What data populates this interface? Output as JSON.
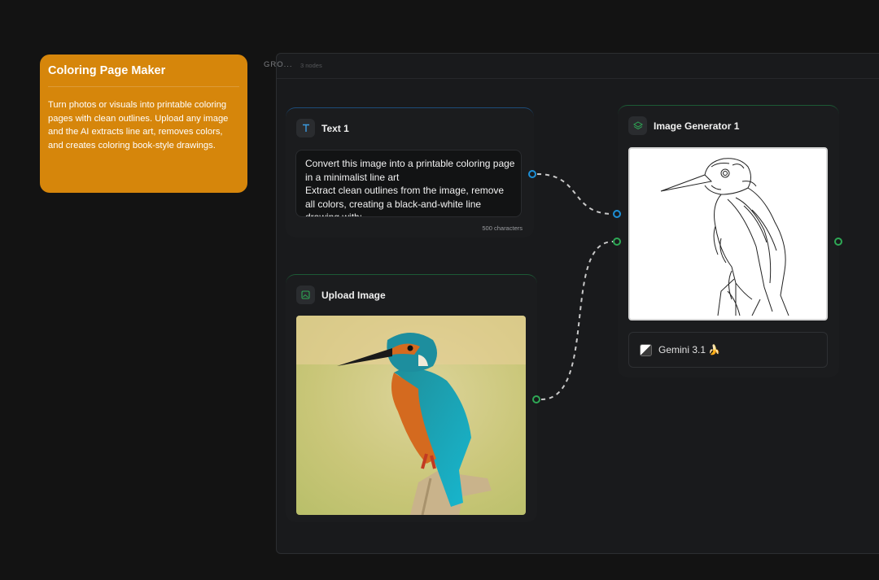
{
  "note": {
    "title": "Coloring Page Maker",
    "body": "Turn photos or visuals into printable coloring pages with clean outlines. Upload any image and the AI extracts line art, removes colors, and creates coloring book-style drawings."
  },
  "group": {
    "label": "GRO...",
    "count": "3 nodes"
  },
  "text_node": {
    "title": "Text 1",
    "icon": "text-T-icon",
    "prompt_lines": [
      "Convert this image into a printable coloring page",
      "in a minimalist line art",
      "Extract clean outlines from the image, remove",
      "all colors, creating a black-and-white line",
      "drawing with:"
    ],
    "char_count": "500 characters"
  },
  "upload_node": {
    "title": "Upload Image",
    "icon": "image-icon"
  },
  "generator_node": {
    "title": "Image Generator 1",
    "icon": "layers-icon",
    "model": "Gemini 3.1 🍌"
  },
  "colors": {
    "note_bg": "#d6860b",
    "blue_port": "#1d8fd6",
    "green_port": "#2ea855",
    "canvas_bg": "#131313"
  }
}
